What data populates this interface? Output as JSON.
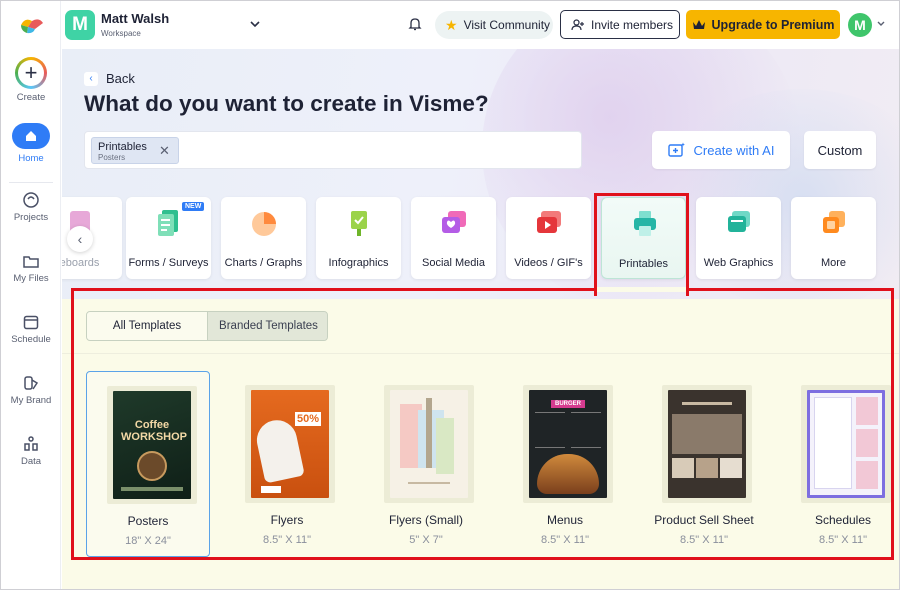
{
  "sidebar": {
    "items": [
      {
        "label": "Create",
        "icon": "plus-icon"
      },
      {
        "label": "Home",
        "icon": "home-icon"
      },
      {
        "label": "Projects",
        "icon": "projects-icon"
      },
      {
        "label": "My Files",
        "icon": "folder-icon"
      },
      {
        "label": "Schedule",
        "icon": "calendar-icon"
      },
      {
        "label": "My Brand",
        "icon": "brand-icon"
      },
      {
        "label": "Data",
        "icon": "data-icon"
      }
    ]
  },
  "workspace": {
    "avatar_letter": "M",
    "name": "Matt Walsh",
    "sub": "Workspace"
  },
  "topbar": {
    "community": "Visit Community",
    "invite": "Invite members",
    "upgrade": "Upgrade to Premium",
    "user_letter": "M"
  },
  "hero": {
    "back": "Back",
    "title": "What do you want to create in Visme?",
    "chip_main": "Printables",
    "chip_sub": "Posters",
    "ai_button": "Create with AI",
    "custom_button": "Custom"
  },
  "categories": [
    {
      "label": "eboards"
    },
    {
      "label": "Forms / Surveys",
      "badge": "NEW"
    },
    {
      "label": "Charts / Graphs"
    },
    {
      "label": "Infographics"
    },
    {
      "label": "Social Media"
    },
    {
      "label": "Videos / GIF's"
    },
    {
      "label": "Printables"
    },
    {
      "label": "Web Graphics"
    },
    {
      "label": "More"
    }
  ],
  "tabs": {
    "all": "All Templates",
    "branded": "Branded Templates"
  },
  "templates": [
    {
      "name": "Posters",
      "size": "18\" X 24\"",
      "thumb_text": "Coffee WORKSHOP"
    },
    {
      "name": "Flyers",
      "size": "8.5\" X 11\"",
      "thumb_text": "50%"
    },
    {
      "name": "Flyers (Small)",
      "size": "5\" X 7\""
    },
    {
      "name": "Menus",
      "size": "8.5\" X 11\"",
      "thumb_text": "BURGER"
    },
    {
      "name": "Product Sell Sheet",
      "size": "8.5\" X 11\""
    },
    {
      "name": "Schedules",
      "size": "8.5\" X 11\""
    }
  ],
  "colors": {
    "accent": "#2f7cf6",
    "upgrade": "#f7b500",
    "highlight": "#e0101b"
  }
}
